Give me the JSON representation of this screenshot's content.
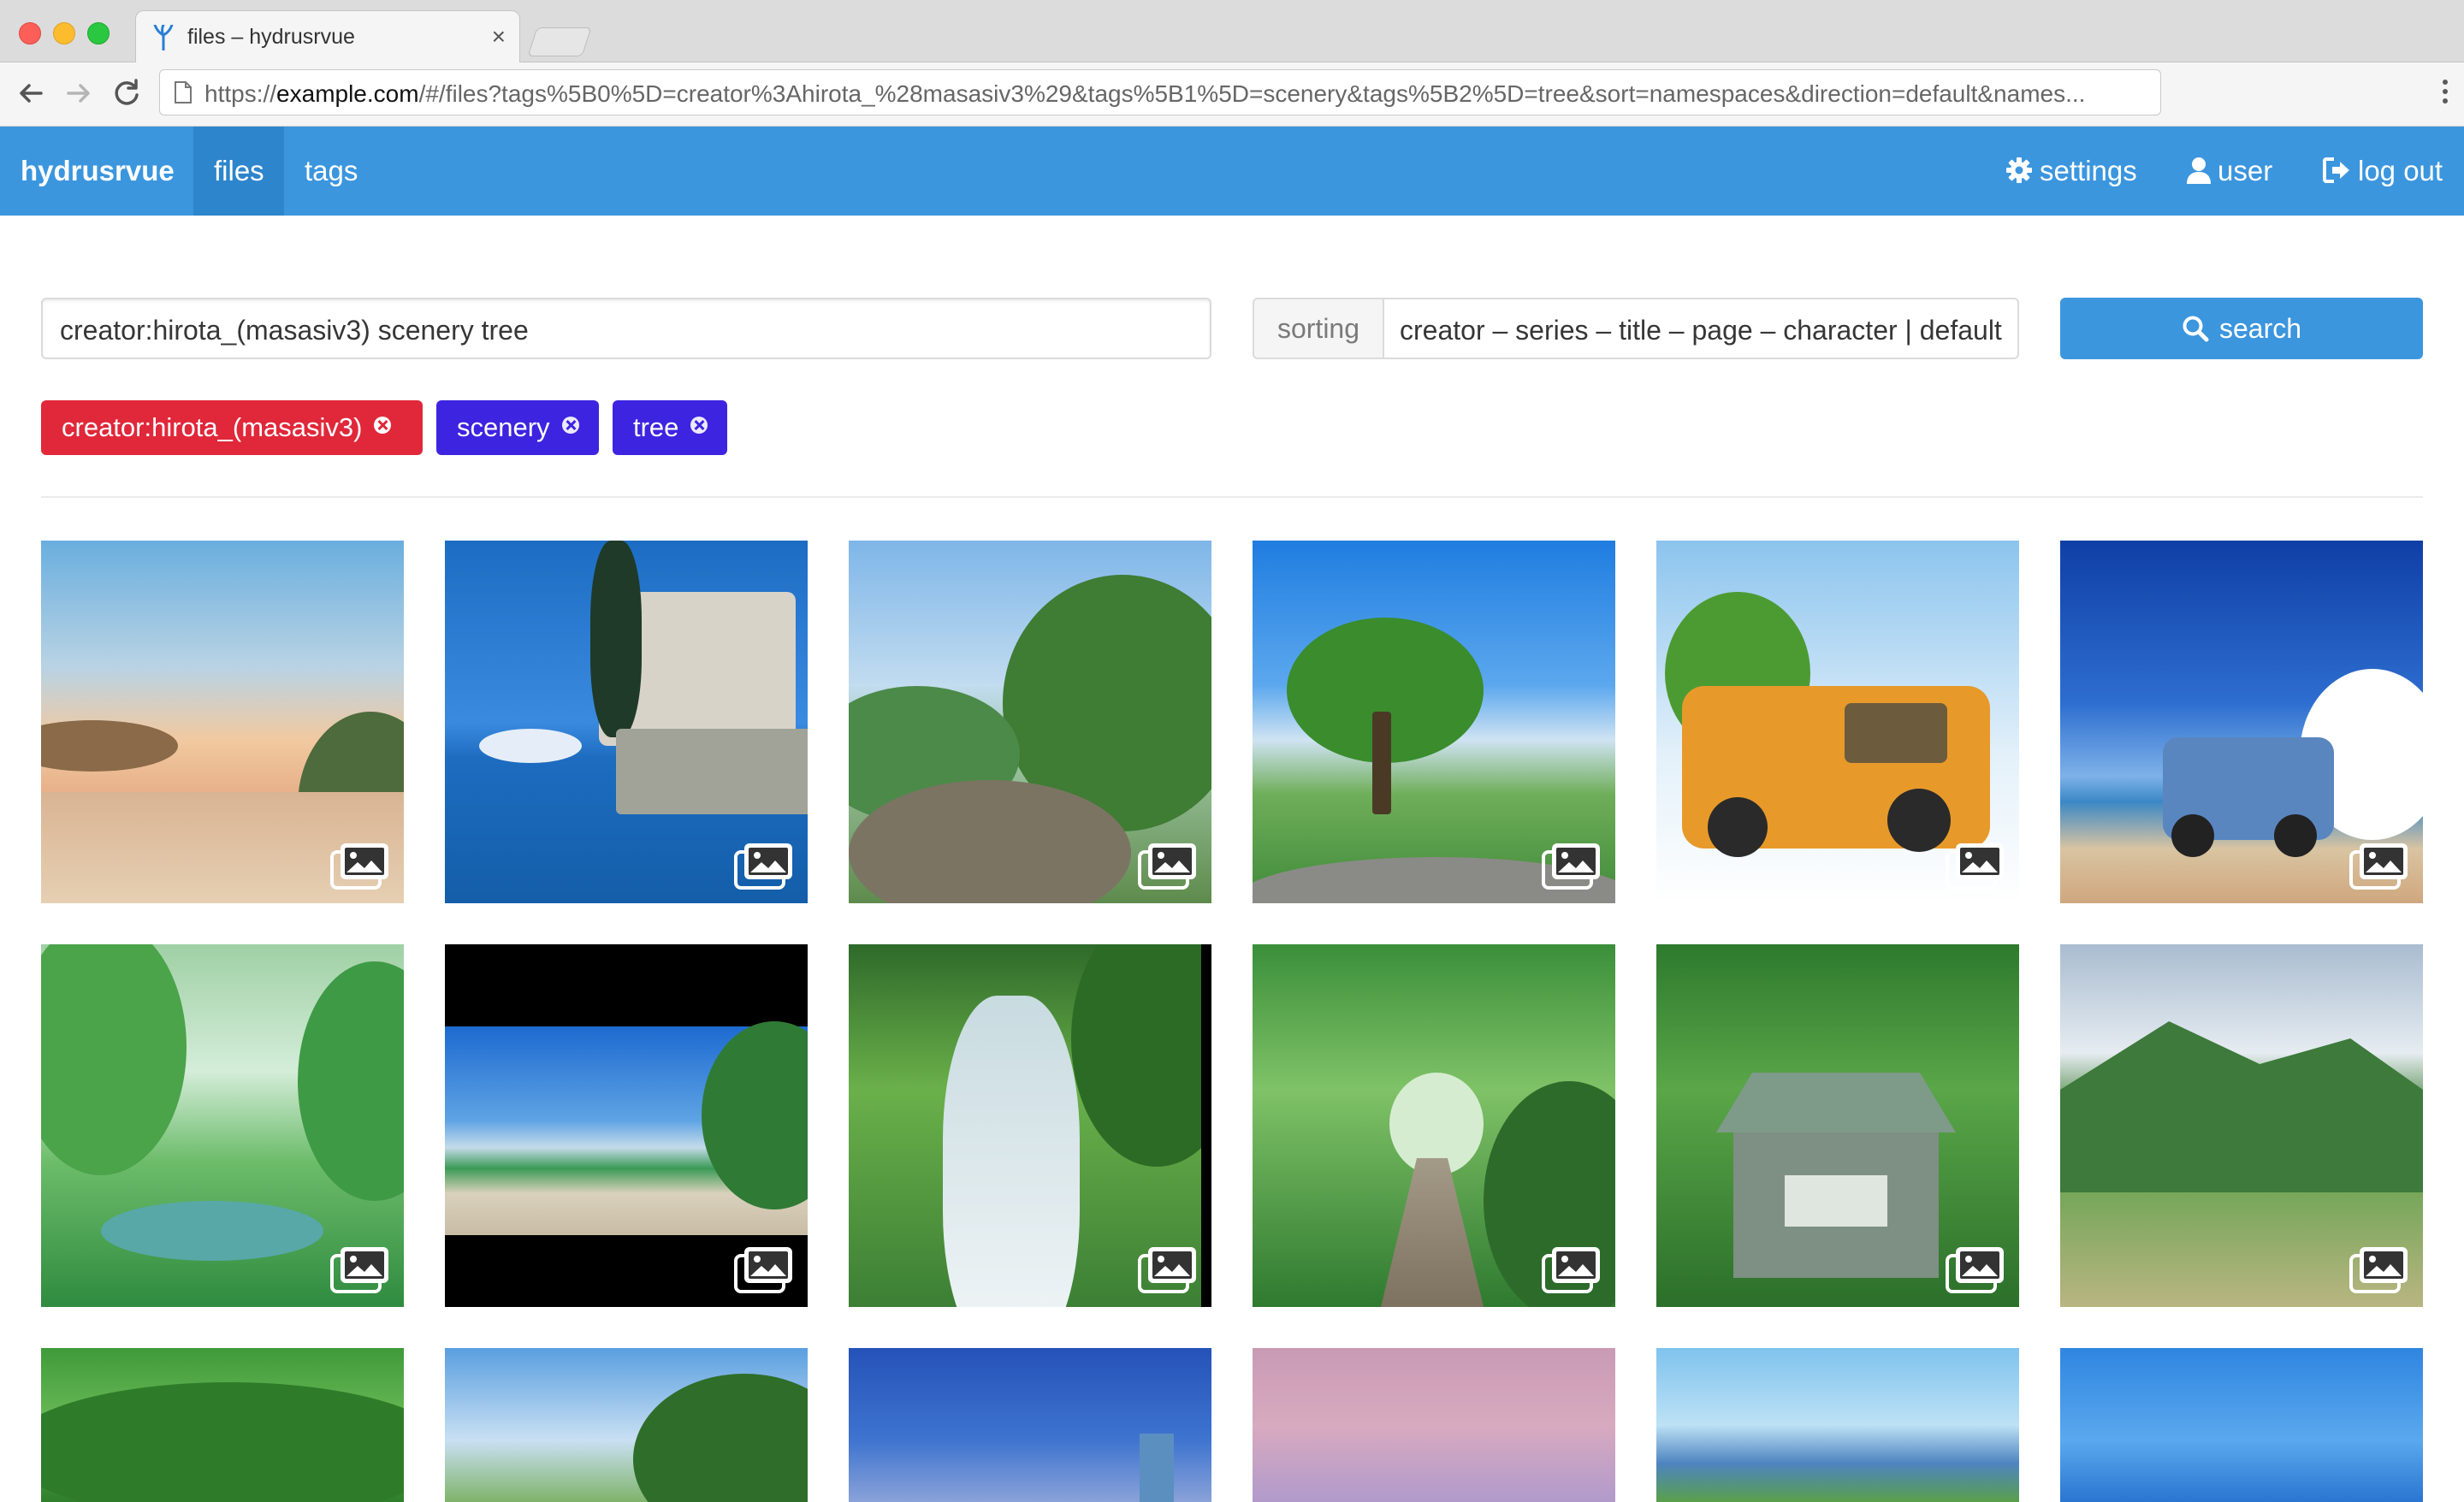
{
  "browser": {
    "tab_title": "files – hydrusrvue",
    "tab_close": "×",
    "url_prefix": "https://",
    "url_host": "example.com",
    "url_rest": "/#/files?tags%5B0%5D=creator%3Ahirota_%28masasiv3%29&tags%5B1%5D=scenery&tags%5B2%5D=tree&sort=namespaces&direction=default&names..."
  },
  "navbar": {
    "brand": "hydrusrvue",
    "files": "files",
    "tags": "tags",
    "settings": "settings",
    "user": "user",
    "logout": "log out"
  },
  "search": {
    "query": "creator:hirota_(masasiv3) scenery tree",
    "sorting_label": "sorting",
    "sorting_value": "creator – series – title – page – character | default",
    "button": "search"
  },
  "tags": [
    {
      "label": "creator:hirota_(masasiv3)",
      "color": "#e0283a"
    },
    {
      "label": "scenery",
      "color": "#3d24e0"
    },
    {
      "label": "tree",
      "color": "#3d24e0"
    }
  ],
  "colors": {
    "accent": "#3b96de",
    "accent_active": "#2d85cc",
    "namespace_tag": "#e0283a",
    "plain_tag": "#3d24e0"
  },
  "thumbnails": [
    {
      "icon": "image-icon"
    },
    {
      "icon": "image-icon"
    },
    {
      "icon": "image-icon"
    },
    {
      "icon": "image-icon"
    },
    {
      "icon": "image-icon"
    },
    {
      "icon": "image-icon"
    },
    {
      "icon": "image-icon"
    },
    {
      "icon": "image-icon"
    },
    {
      "icon": "image-icon"
    },
    {
      "icon": "image-icon"
    },
    {
      "icon": "image-icon"
    },
    {
      "icon": "image-icon"
    },
    {
      "icon": "none"
    },
    {
      "icon": "none"
    },
    {
      "icon": "none"
    },
    {
      "icon": "none"
    },
    {
      "icon": "none"
    },
    {
      "icon": "none"
    }
  ]
}
